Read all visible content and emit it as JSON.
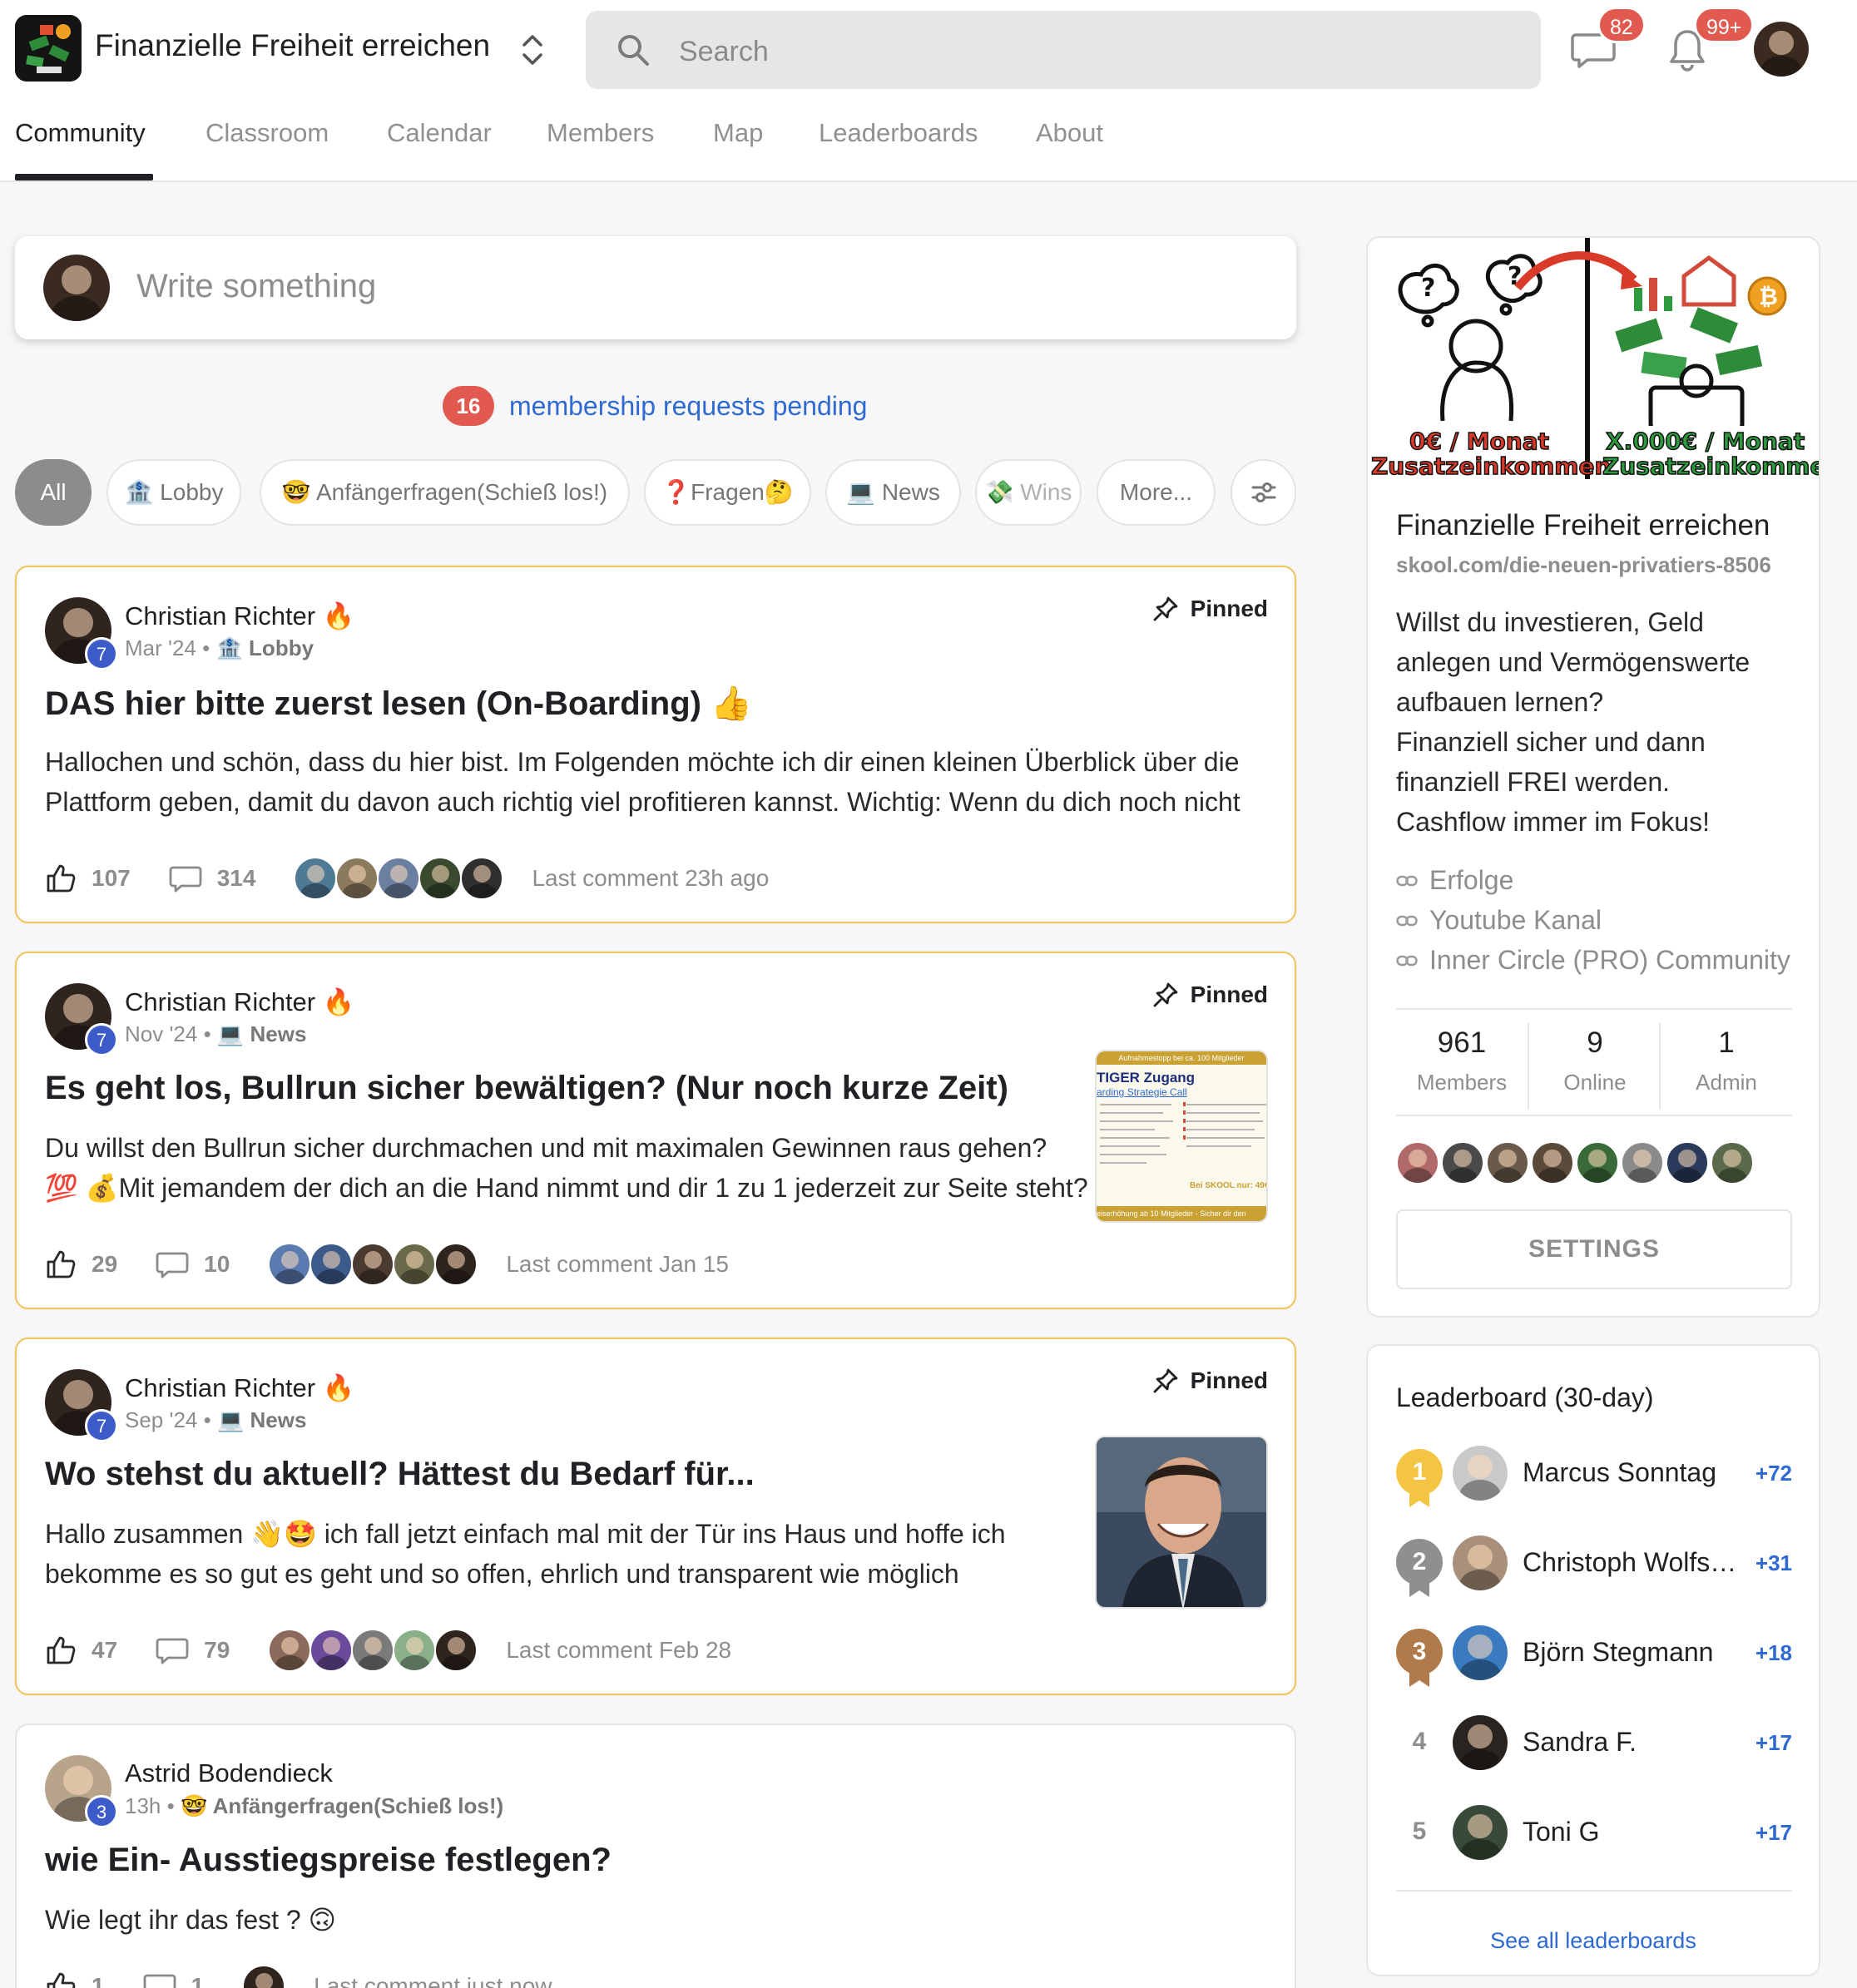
{
  "header": {
    "group_name": "Finanzielle Freiheit erreichen",
    "search_placeholder": "Search",
    "chat_badge": "82",
    "notification_badge": "99+"
  },
  "nav": {
    "tabs": [
      {
        "label": "Community",
        "active": true
      },
      {
        "label": "Classroom",
        "active": false
      },
      {
        "label": "Calendar",
        "active": false
      },
      {
        "label": "Members",
        "active": false
      },
      {
        "label": "Map",
        "active": false
      },
      {
        "label": "Leaderboards",
        "active": false
      },
      {
        "label": "About",
        "active": false
      }
    ]
  },
  "composer": {
    "placeholder": "Write something"
  },
  "pending": {
    "count": "16",
    "text": "membership requests pending"
  },
  "filters": {
    "pills": [
      "All",
      "🏦 Lobby",
      "🤓 Anfängerfragen(Schieß los!)",
      "❓Fragen🤔",
      "💻 News",
      "💸 Wins",
      "More..."
    ],
    "active": "All"
  },
  "posts": [
    {
      "author": "Christian Richter 🔥",
      "level": "7",
      "date": "Mar '24",
      "category": "🏦 Lobby",
      "pinned_label": "Pinned",
      "title": "DAS hier bitte zuerst lesen (On-Boarding) 👍",
      "body_line1": "Hallochen und schön, dass du hier bist. Im Folgenden möchte ich dir einen kleinen Überblick über die",
      "body_line2": "Plattform geben, damit du davon auch richtig viel profitieren kannst. Wichtig: Wenn du dich noch nicht",
      "likes": "107",
      "comments": "314",
      "last_comment": "Last comment 23h ago"
    },
    {
      "author": "Christian Richter 🔥",
      "level": "7",
      "date": "Nov '24",
      "category": "💻 News",
      "pinned_label": "Pinned",
      "title": "Es geht los, Bullrun sicher bewältigen? (Nur noch kurze Zeit)",
      "body_line1": "Du willst den Bullrun sicher durchmachen und mit maximalen Gewinnen raus gehen?",
      "body_line2": "💯 💰Mit jemandem der dich an die Hand nimmt und dir 1 zu 1 jederzeit zur Seite steht?",
      "likes": "29",
      "comments": "10",
      "last_comment": "Last comment Jan 15",
      "thumb_top": "Aufnahmestopp bei ca. 100 Mitglieder",
      "thumb_heading": "TIGER Zugang",
      "thumb_sub": "arding Strategie Call",
      "thumb_price": "Bei SKOOL nur: 49€",
      "thumb_bottom": "eiserhöhung ab 10 Mitglieder - Sicher dir den"
    },
    {
      "author": "Christian Richter 🔥",
      "level": "7",
      "date": "Sep '24",
      "category": "💻 News",
      "pinned_label": "Pinned",
      "title": "Wo stehst du aktuell? Hättest du Bedarf für...",
      "body_line1": "Hallo zusammen 👋🤩 ich fall jetzt einfach mal mit der Tür ins Haus und hoffe ich",
      "body_line2": "bekomme es so gut es geht und so offen, ehrlich und transparent wie möglich",
      "likes": "47",
      "comments": "79",
      "last_comment": "Last comment Feb 28"
    },
    {
      "author": "Astrid Bodendieck",
      "level": "3",
      "date": "13h",
      "category": "🤓 Anfängerfragen(Schieß los!)",
      "title": "wie Ein- Ausstiegspreise festlegen?",
      "body_line1": "Wie legt ihr das fest ? 🙃",
      "likes": "1",
      "comments": "1",
      "last_comment": "Last comment just now"
    }
  ],
  "about": {
    "cover_left": "0€ / Monat",
    "cover_left2": "Zusatzeinkommen",
    "cover_right": "X.000€ / Monat",
    "cover_right2": "Zusatzeinkommen",
    "name": "Finanzielle Freiheit erreichen",
    "url": "skool.com/die-neuen-privatiers-8506",
    "desc": [
      "Willst du investieren, Geld",
      "anlegen und Vermögenswerte",
      "aufbauen lernen?",
      "Finanziell sicher und dann",
      "finanziell FREI werden.",
      "Cashflow immer im Fokus!"
    ],
    "links": [
      "Erfolge",
      "Youtube Kanal",
      "Inner Circle (PRO) Community"
    ],
    "stats": [
      {
        "value": "961",
        "label": "Members"
      },
      {
        "value": "9",
        "label": "Online"
      },
      {
        "value": "1",
        "label": "Admin"
      }
    ],
    "settings_label": "SETTINGS"
  },
  "leaderboard": {
    "title": "Leaderboard (30-day)",
    "rows": [
      {
        "rank": "1",
        "name": "Marcus Sonntag",
        "points": "+72"
      },
      {
        "rank": "2",
        "name": "Christoph Wolfschmidt",
        "points": "+31"
      },
      {
        "rank": "3",
        "name": "Björn Stegmann",
        "points": "+18"
      },
      {
        "rank": "4",
        "name": "Sandra F.",
        "points": "+17"
      },
      {
        "rank": "5",
        "name": "Toni G",
        "points": "+17"
      }
    ],
    "see_all": "See all leaderboards"
  },
  "colors": {
    "accent_blue": "#2e6ad1",
    "badge_red": "#e25950",
    "pinned_border": "#f0c563",
    "level_blue": "#3d5bc9",
    "gold": "#f4c542",
    "silver": "#8f8f8f",
    "bronze": "#b07a4a"
  }
}
